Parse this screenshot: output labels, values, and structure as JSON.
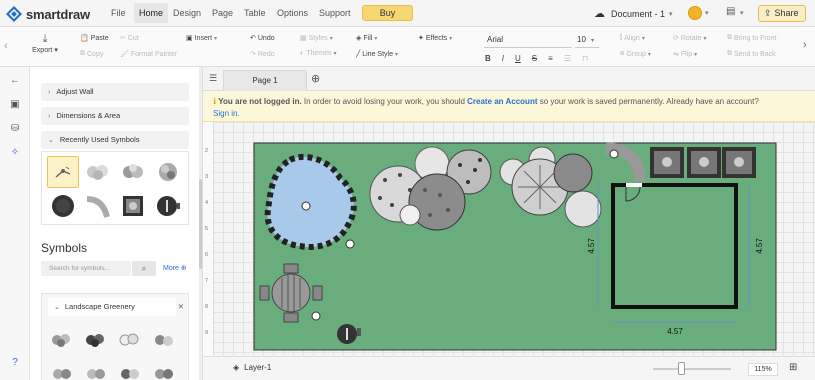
{
  "app": {
    "name": "smartdraw"
  },
  "menu": {
    "items": [
      "File",
      "Home",
      "Design",
      "Page",
      "Table",
      "Options",
      "Support"
    ],
    "active": "Home",
    "buy_label": "Buy"
  },
  "document": {
    "title": "Document - 1"
  },
  "share_label": "Share",
  "ribbon": {
    "export": "Export",
    "paste": "Paste",
    "copy": "Copy",
    "cut": "Cut",
    "format_painter": "Format Painter",
    "insert": "Insert",
    "undo": "Undo",
    "redo": "Redo",
    "styles": "Styles",
    "themes": "Themes",
    "fill": "Fill",
    "line_style": "Line Style",
    "effects": "Effects",
    "font": "Arial",
    "font_size": "10",
    "align": "Align",
    "group": "Group",
    "rotate": "Rotate",
    "flip": "Flip",
    "bring_to_front": "Bring to Front",
    "send_to_back": "Send to Back"
  },
  "panel": {
    "sections": [
      "Adjust Wall",
      "Dimensions & Area",
      "Recently Used Symbols"
    ],
    "symbols_title": "Symbols",
    "search_placeholder": "Search for symbols...",
    "more_label": "More",
    "library": "Landscape Greenery"
  },
  "canvas": {
    "page_tab": "Page 1",
    "notice": {
      "bold": "You are not logged in.",
      "text1": " In order to avoid losing your work, you should ",
      "link1": "Create an Account",
      "text2": " so your work is saved permanently. Already have an account?",
      "link2": "Sign in."
    },
    "ruler_numbers": [
      "2",
      "3",
      "4",
      "5",
      "6",
      "7",
      "8",
      "9"
    ],
    "dimensions": {
      "left": "4.57",
      "right": "4.57",
      "bottom": "4.57"
    }
  },
  "bottom": {
    "layer": "Layer-1",
    "zoom": "115%"
  },
  "colors": {
    "lawn": "#6aad7c",
    "pond": "#a9c9ea",
    "buy": "#f7d774",
    "link": "#2a6fcf"
  }
}
